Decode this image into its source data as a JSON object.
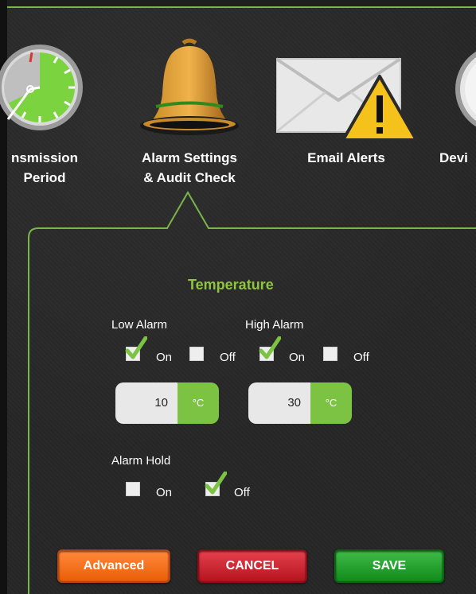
{
  "nav": {
    "items": [
      {
        "label": "nsmission\nPeriod",
        "icon": "clock-icon"
      },
      {
        "label": "Alarm Settings\n& Audit Check",
        "icon": "bell-icon"
      },
      {
        "label": "Email Alerts",
        "icon": "envelope-warning-icon"
      },
      {
        "label": "Devi",
        "icon": "compass-icon"
      }
    ]
  },
  "temperature": {
    "title": "Temperature",
    "low_alarm": {
      "label": "Low Alarm",
      "on_label": "On",
      "off_label": "Off",
      "on_checked": true,
      "off_checked": false,
      "value": "10",
      "unit": "°C"
    },
    "high_alarm": {
      "label": "High Alarm",
      "on_label": "On",
      "off_label": "Off",
      "on_checked": true,
      "off_checked": false,
      "value": "30",
      "unit": "°C"
    },
    "alarm_hold": {
      "label": "Alarm Hold",
      "on_label": "On",
      "off_label": "Off",
      "on_checked": false,
      "off_checked": true
    }
  },
  "buttons": {
    "advanced": "Advanced",
    "cancel": "CANCEL",
    "save": "SAVE"
  },
  "colors": {
    "accent_green": "#8dc63f",
    "unit_green": "#7cc243",
    "advanced_orange": "#ea5d06",
    "cancel_red": "#b5141f",
    "save_green": "#118b1b"
  }
}
